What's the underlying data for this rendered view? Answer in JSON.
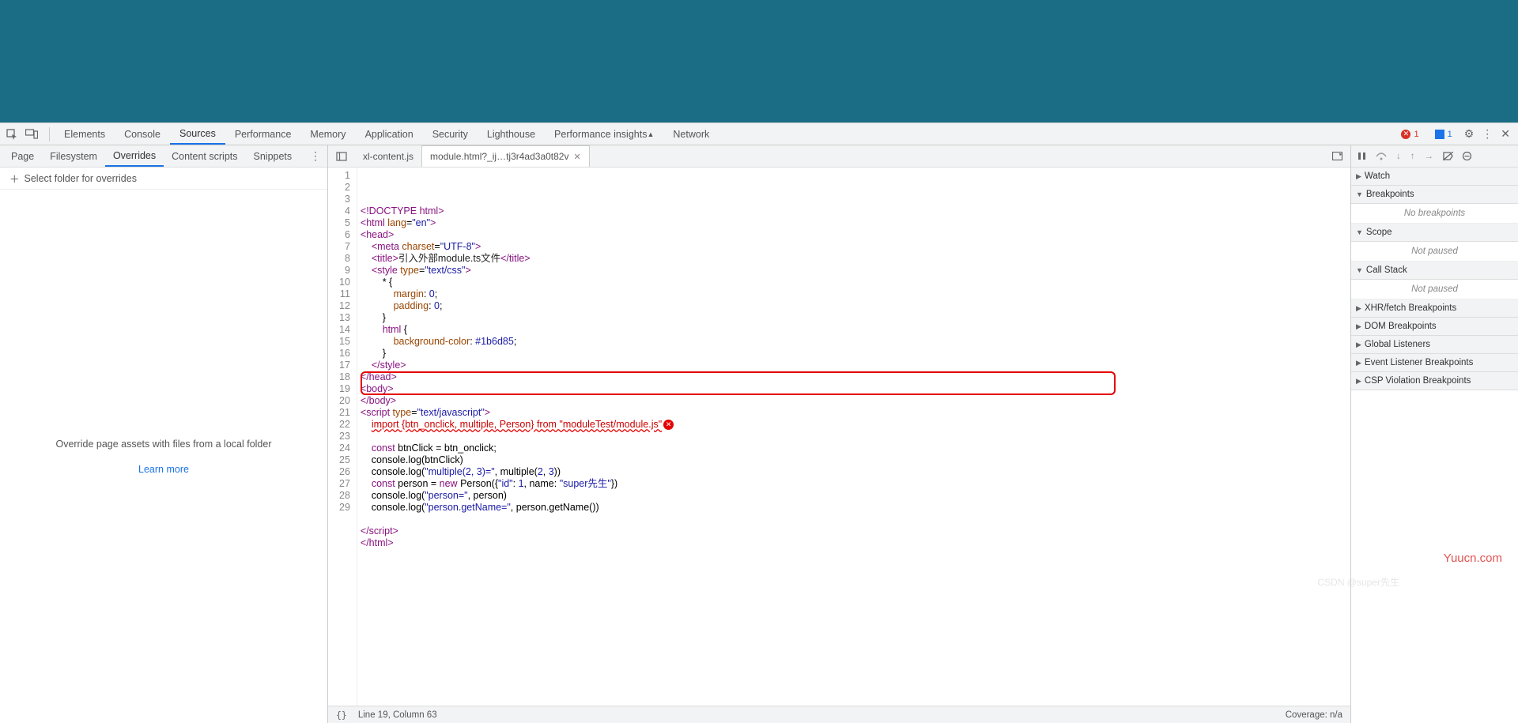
{
  "main_tabs": [
    "Elements",
    "Console",
    "Sources",
    "Performance",
    "Memory",
    "Application",
    "Security",
    "Lighthouse",
    "Performance insights",
    "Network"
  ],
  "main_active": "Sources",
  "err_count": "1",
  "info_count": "1",
  "sub_tabs": [
    "Page",
    "Filesystem",
    "Overrides",
    "Content scripts",
    "Snippets"
  ],
  "sub_active": "Overrides",
  "select_folder": "Select folder for overrides",
  "left_msg": "Override page assets with files from a local folder",
  "learn_more": "Learn more",
  "file_tabs": [
    {
      "name": "xl-content.js",
      "active": false,
      "close": false
    },
    {
      "name": "module.html?_ij…tj3r4ad3a0t82v",
      "active": true,
      "close": true
    }
  ],
  "code_lines": [
    [
      [
        "t-tag",
        "<!DOCTYPE html>"
      ]
    ],
    [
      [
        "t-tag",
        "<html"
      ],
      [
        "",
        ""
      ],
      [
        "t-attr",
        " lang"
      ],
      [
        "",
        "="
      ],
      [
        "t-str",
        "\"en\""
      ],
      [
        "t-tag",
        ">"
      ]
    ],
    [
      [
        "t-tag",
        "<head>"
      ]
    ],
    [
      [
        "",
        "    "
      ],
      [
        "t-tag",
        "<meta"
      ],
      [
        "t-attr",
        " charset"
      ],
      [
        "",
        "="
      ],
      [
        "t-str",
        "\"UTF-8\""
      ],
      [
        "t-tag",
        ">"
      ]
    ],
    [
      [
        "",
        "    "
      ],
      [
        "t-tag",
        "<title>"
      ],
      [
        "t-txt",
        "引入外部module.ts文件"
      ],
      [
        "t-tag",
        "</title>"
      ]
    ],
    [
      [
        "",
        "    "
      ],
      [
        "t-tag",
        "<style"
      ],
      [
        "t-attr",
        " type"
      ],
      [
        "",
        "="
      ],
      [
        "t-str",
        "\"text/css\""
      ],
      [
        "t-tag",
        ">"
      ]
    ],
    [
      [
        "",
        "        * {"
      ]
    ],
    [
      [
        "",
        "            "
      ],
      [
        "t-prop",
        "margin"
      ],
      [
        "",
        ": "
      ],
      [
        "t-num",
        "0"
      ],
      [
        "",
        ";"
      ]
    ],
    [
      [
        "",
        "            "
      ],
      [
        "t-prop",
        "padding"
      ],
      [
        "",
        ": "
      ],
      [
        "t-num",
        "0"
      ],
      [
        "",
        ";"
      ]
    ],
    [
      [
        "",
        "        }"
      ]
    ],
    [
      [
        "",
        "        "
      ],
      [
        "t-tag",
        "html"
      ],
      [
        "",
        " {"
      ]
    ],
    [
      [
        "",
        "            "
      ],
      [
        "t-prop",
        "background-color"
      ],
      [
        "",
        ": "
      ],
      [
        "t-num",
        "#1b6d85"
      ],
      [
        "",
        ";"
      ]
    ],
    [
      [
        "",
        "        }"
      ]
    ],
    [
      [
        "",
        "    "
      ],
      [
        "t-tag",
        "</style>"
      ]
    ],
    [
      [
        "t-tag",
        "</head>"
      ]
    ],
    [
      [
        "t-tag",
        "<body>"
      ]
    ],
    [
      [
        "t-tag",
        "</body>"
      ]
    ],
    [
      [
        "t-tag",
        "<script"
      ],
      [
        "t-attr",
        " type"
      ],
      [
        "",
        "="
      ],
      [
        "t-str",
        "\"text/javascript\""
      ],
      [
        "t-tag",
        ">"
      ]
    ],
    [
      [
        "",
        "    "
      ],
      [
        "err-line",
        "import {btn_onclick, multiple, Person} from \"moduleTest/module.js\""
      ]
    ],
    [
      [
        "",
        ""
      ]
    ],
    [
      [
        "",
        "    "
      ],
      [
        "t-kw",
        "const"
      ],
      [
        "",
        " btnClick = btn_onclick;"
      ]
    ],
    [
      [
        "",
        "    console.log(btnClick)"
      ]
    ],
    [
      [
        "",
        "    console.log("
      ],
      [
        "t-str",
        "\"multiple(2, 3)=\""
      ],
      [
        "",
        ", multiple("
      ],
      [
        "t-num",
        "2"
      ],
      [
        "",
        ", "
      ],
      [
        "t-num",
        "3"
      ],
      [
        "",
        "))"
      ]
    ],
    [
      [
        "",
        "    "
      ],
      [
        "t-kw",
        "const"
      ],
      [
        "",
        " person = "
      ],
      [
        "t-kw",
        "new"
      ],
      [
        "",
        " Person({"
      ],
      [
        "t-str",
        "\"id\""
      ],
      [
        "",
        ": "
      ],
      [
        "t-num",
        "1"
      ],
      [
        "",
        ", name: "
      ],
      [
        "t-str",
        "\"super先生\""
      ],
      [
        "",
        "})"
      ]
    ],
    [
      [
        "",
        "    console.log("
      ],
      [
        "t-str",
        "\"person=\""
      ],
      [
        "",
        ", person)"
      ]
    ],
    [
      [
        "",
        "    console.log("
      ],
      [
        "t-str",
        "\"person.getName=\""
      ],
      [
        "",
        ", person.getName())"
      ]
    ],
    [
      [
        "",
        ""
      ]
    ],
    [
      [
        "t-tag",
        "</script"
      ],
      [
        "t-tag",
        ">"
      ]
    ],
    [
      [
        "t-tag",
        "</html>"
      ]
    ]
  ],
  "status": {
    "pos": "Line 19, Column 63",
    "coverage": "Coverage: n/a"
  },
  "right_sections": [
    {
      "label": "Watch",
      "open": false
    },
    {
      "label": "Breakpoints",
      "open": true,
      "body": "No breakpoints"
    },
    {
      "label": "Scope",
      "open": true,
      "body": "Not paused"
    },
    {
      "label": "Call Stack",
      "open": true,
      "body": "Not paused"
    },
    {
      "label": "XHR/fetch Breakpoints",
      "open": false
    },
    {
      "label": "DOM Breakpoints",
      "open": false
    },
    {
      "label": "Global Listeners",
      "open": false
    },
    {
      "label": "Event Listener Breakpoints",
      "open": false
    },
    {
      "label": "CSP Violation Breakpoints",
      "open": false
    }
  ],
  "watermark": "Yuucn.com",
  "watermark2": "CSDN @super先生"
}
